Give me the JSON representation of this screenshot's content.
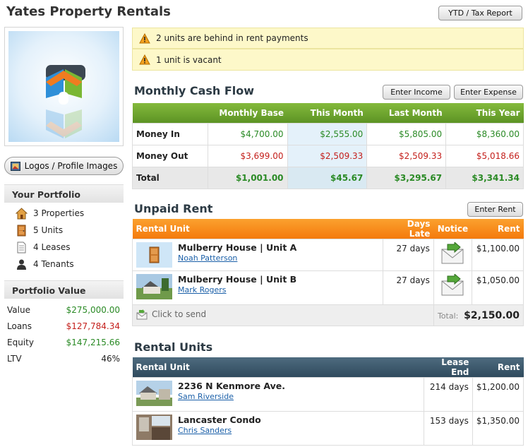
{
  "header": {
    "title": "Yates Property Rentals",
    "report_button": "YTD / Tax Report"
  },
  "sidebar": {
    "logo_button": "Logos / Profile Images",
    "portfolio_heading": "Your Portfolio",
    "portfolio_items": [
      {
        "label": "3 Properties",
        "icon": "house-icon"
      },
      {
        "label": "5 Units",
        "icon": "door-icon"
      },
      {
        "label": "4 Leases",
        "icon": "document-icon"
      },
      {
        "label": "4 Tenants",
        "icon": "person-icon"
      }
    ],
    "value_heading": "Portfolio Value",
    "values": [
      {
        "label": "Value",
        "amount": "$275,000.00",
        "color": "green"
      },
      {
        "label": "Loans",
        "amount": "$127,784.34",
        "color": "red"
      },
      {
        "label": "Equity",
        "amount": "$147,215.66",
        "color": "green"
      },
      {
        "label": "LTV",
        "amount": "46%",
        "color": "black"
      }
    ]
  },
  "alerts": [
    "2 units are behind in rent payments",
    "1 unit is vacant"
  ],
  "cash_flow": {
    "title": "Monthly Cash Flow",
    "enter_income": "Enter Income",
    "enter_expense": "Enter Expense",
    "columns": [
      "Monthly Base",
      "This Month",
      "Last Month",
      "This Year"
    ],
    "rows": [
      {
        "label": "Money In",
        "values": [
          "$4,700.00",
          "$2,555.00",
          "$5,805.00",
          "$8,360.00"
        ]
      },
      {
        "label": "Money Out",
        "values": [
          "$3,699.00",
          "$2,509.33",
          "$2,509.33",
          "$5,018.66"
        ]
      },
      {
        "label": "Total",
        "values": [
          "$1,001.00",
          "$45.67",
          "$3,295.67",
          "$3,341.34"
        ]
      }
    ]
  },
  "unpaid_rent": {
    "title": "Unpaid Rent",
    "enter_rent": "Enter Rent",
    "columns": {
      "unit": "Rental Unit",
      "days": "Days Late",
      "notice": "Notice",
      "rent": "Rent"
    },
    "rows": [
      {
        "unit": "Mulberry House | Unit A",
        "tenant": "Noah Patterson",
        "days": "27 days",
        "rent": "$1,100.00"
      },
      {
        "unit": "Mulberry House | Unit B",
        "tenant": "Mark Rogers",
        "days": "27 days",
        "rent": "$1,050.00"
      }
    ],
    "click_to_send": "Click to send",
    "total_label": "Total:",
    "total_value": "$2,150.00"
  },
  "rental_units": {
    "title": "Rental Units",
    "columns": {
      "unit": "Rental Unit",
      "lease_end": "Lease End",
      "rent": "Rent"
    },
    "rows": [
      {
        "unit": "2236 N Kenmore Ave.",
        "tenant": "Sam Riverside",
        "lease_end": "214 days",
        "rent": "$1,200.00"
      },
      {
        "unit": "Lancaster Condo",
        "tenant": "Chris Sanders",
        "lease_end": "153 days",
        "rent": "$1,350.00"
      }
    ]
  }
}
